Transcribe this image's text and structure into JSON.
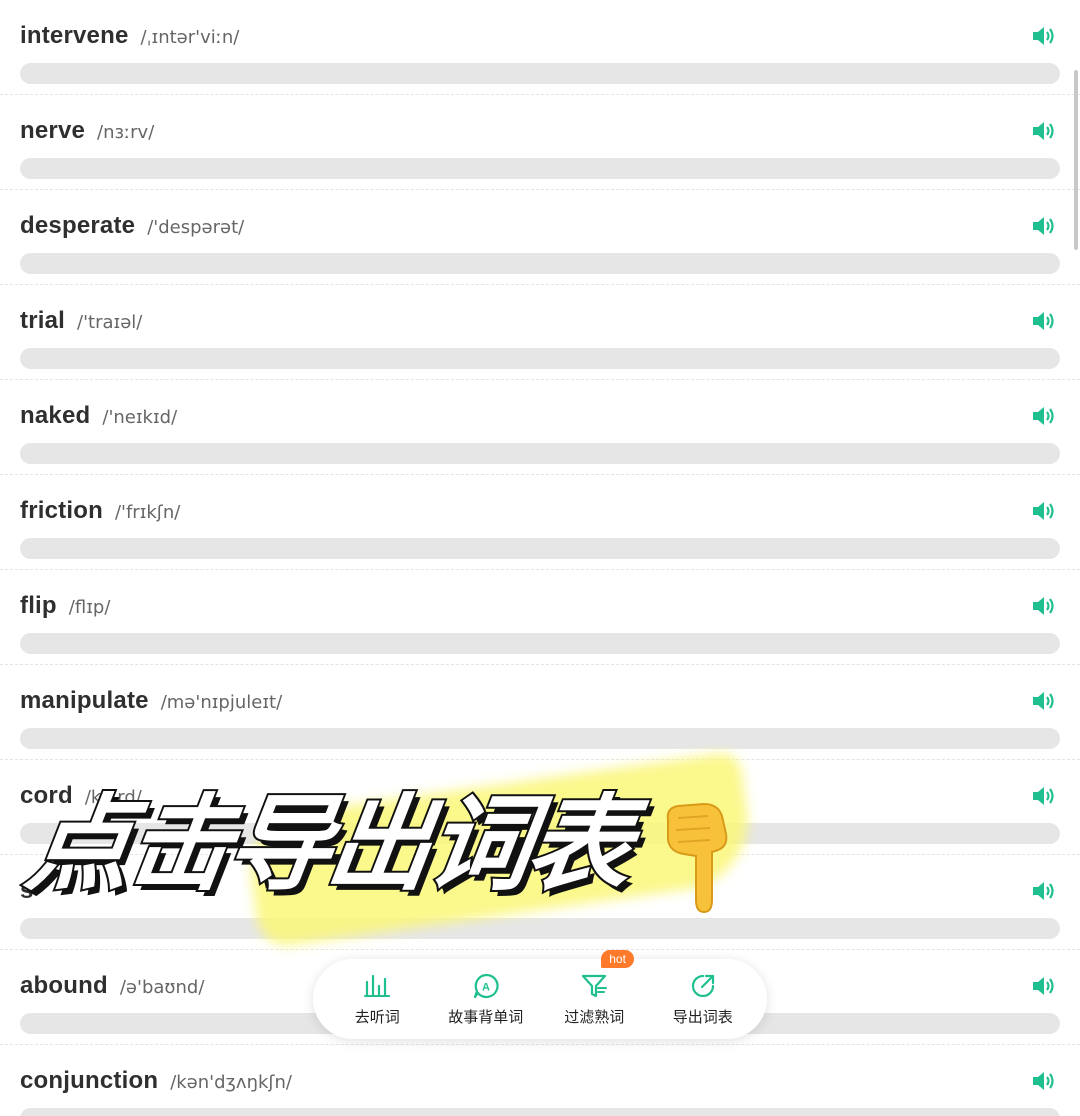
{
  "words": [
    {
      "word": "intervene",
      "phonetic": "/ˌɪntər'viːn/"
    },
    {
      "word": "nerve",
      "phonetic": "/nɜːrv/"
    },
    {
      "word": "desperate",
      "phonetic": "/'despərət/"
    },
    {
      "word": "trial",
      "phonetic": "/'traɪəl/"
    },
    {
      "word": "naked",
      "phonetic": "/'neɪkɪd/"
    },
    {
      "word": "friction",
      "phonetic": "/'frɪkʃn/"
    },
    {
      "word": "flip",
      "phonetic": "/flɪp/"
    },
    {
      "word": "manipulate",
      "phonetic": "/mə'nɪpjuleɪt/"
    },
    {
      "word": "cord",
      "phonetic": "/kɔːrd/"
    },
    {
      "word": "s",
      "phonetic": ""
    },
    {
      "word": "abound",
      "phonetic": "/ə'baʊnd/"
    },
    {
      "word": "conjunction",
      "phonetic": "/kən'dʒʌŋkʃn/"
    }
  ],
  "promo": {
    "text": "点击导出词表"
  },
  "action_bar": {
    "items": [
      {
        "label": "去听词",
        "icon": "audio-bars-icon"
      },
      {
        "label": "故事背单词",
        "icon": "story-a-icon"
      },
      {
        "label": "过滤熟词",
        "icon": "filter-icon",
        "badge": "hot"
      },
      {
        "label": "导出词表",
        "icon": "export-icon"
      }
    ]
  },
  "colors": {
    "accent": "#1fbf8f",
    "hot_badge": "#ff7a2a"
  }
}
